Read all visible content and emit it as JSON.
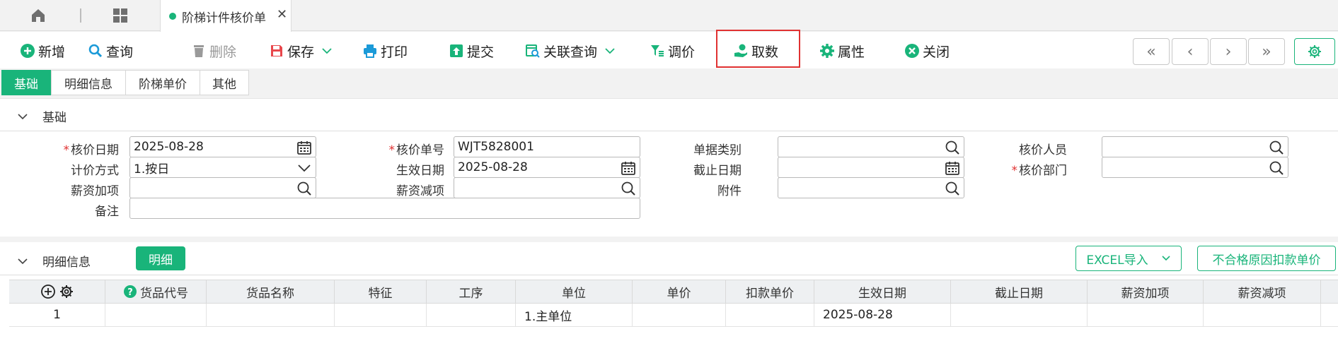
{
  "tab": {
    "title": "阶梯计件核价单"
  },
  "toolbar": {
    "add": "新增",
    "query": "查询",
    "delete": "删除",
    "save": "保存",
    "print": "打印",
    "submit": "提交",
    "related_query": "关联查询",
    "reprice": "调价",
    "fetch": "取数",
    "properties": "属性",
    "close": "关闭"
  },
  "section_tabs": [
    "基础",
    "明细信息",
    "阶梯单价",
    "其他"
  ],
  "base": {
    "title": "基础",
    "fields": {
      "price_date": {
        "label": "核价日期",
        "value": "2025-08-28"
      },
      "price_no": {
        "label": "核价单号",
        "value": "WJT5828001"
      },
      "doc_type": {
        "label": "单据类别",
        "value": ""
      },
      "pricer": {
        "label": "核价人员",
        "value": ""
      },
      "calc_method": {
        "label": "计价方式",
        "value": "1.按日"
      },
      "effective_date": {
        "label": "生效日期",
        "value": "2025-08-28"
      },
      "end_date": {
        "label": "截止日期",
        "value": ""
      },
      "price_dept": {
        "label": "核价部门",
        "value": ""
      },
      "salary_add": {
        "label": "薪资加项",
        "value": ""
      },
      "salary_sub": {
        "label": "薪资减项",
        "value": ""
      },
      "attachment": {
        "label": "附件",
        "value": ""
      },
      "remark": {
        "label": "备注",
        "value": ""
      }
    }
  },
  "detail": {
    "title": "明细信息",
    "detail_btn": "明细",
    "excel_import": "EXCEL导入",
    "deduct_btn": "不合格原因扣款单价",
    "columns": [
      "货品代号",
      "货品名称",
      "特征",
      "工序",
      "单位",
      "单价",
      "扣款单价",
      "生效日期",
      "截止日期",
      "薪资加项",
      "薪资减项"
    ],
    "rows": [
      {
        "index": "1",
        "code": "",
        "name": "",
        "feature": "",
        "process": "",
        "unit": "1.主单位",
        "price": "",
        "deduct_price": "",
        "effective": "2025-08-28",
        "end": "",
        "add": "",
        "sub": ""
      }
    ]
  },
  "colors": {
    "accent": "#19b47a",
    "highlight": "#e03131",
    "required": "#e03131"
  }
}
